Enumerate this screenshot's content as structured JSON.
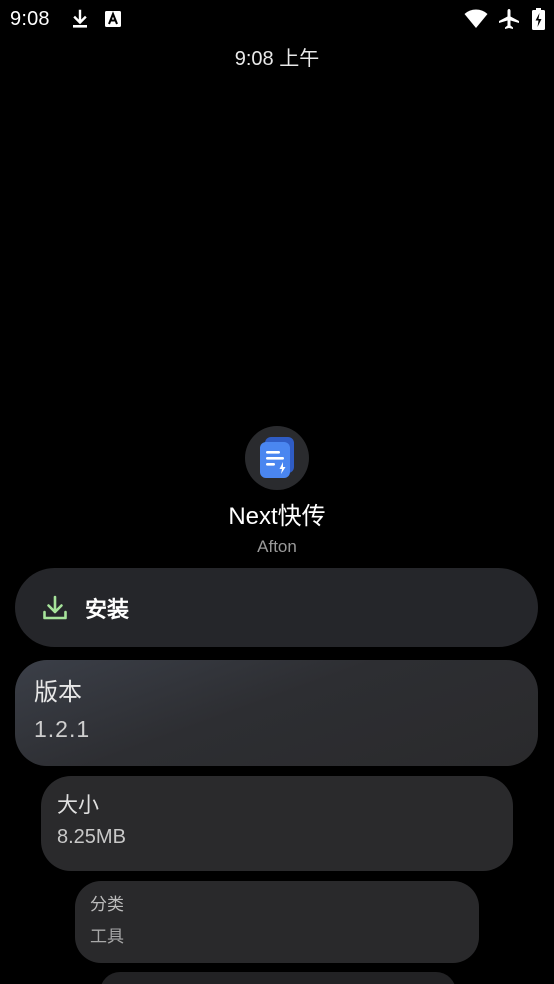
{
  "status_bar": {
    "time": "9:08",
    "left_icons": [
      "download-icon",
      "a-notification-icon"
    ],
    "right_icons": [
      "wifi-icon",
      "airplane-mode-icon",
      "battery-icon"
    ]
  },
  "clock": {
    "text": "9:08 上午"
  },
  "app": {
    "icon": "next-transfer-app-icon",
    "name": "Next快传",
    "developer": "Afton"
  },
  "install": {
    "icon": "download-icon",
    "label": "安装",
    "icon_color": "#a6e39a"
  },
  "info_cards": {
    "version": {
      "label": "版本",
      "value": "1.2.1"
    },
    "size": {
      "label": "大小",
      "value": "8.25MB"
    },
    "category": {
      "label": "分类",
      "value": "工具"
    }
  },
  "colors": {
    "background": "#000000",
    "card": "#2a2a2c",
    "app_icon_blue": "#3b72e8"
  }
}
